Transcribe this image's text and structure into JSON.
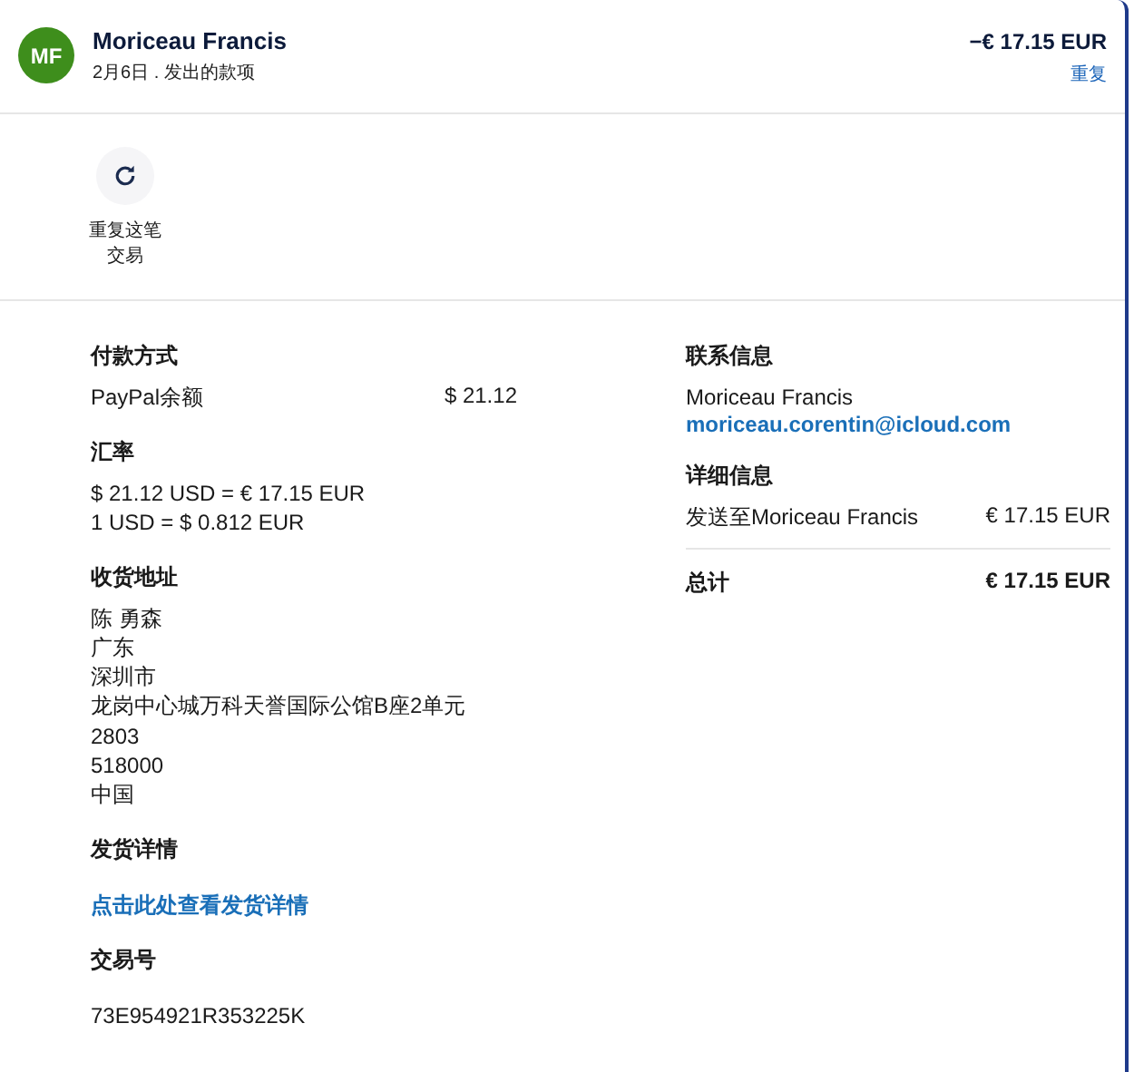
{
  "header": {
    "initials": "MF",
    "name": "Moriceau Francis",
    "subtitle": "2月6日 . 发出的款项",
    "amount": "−€ 17.15 EUR",
    "action": "重复"
  },
  "actions": [
    {
      "label": "重复这笔交易"
    }
  ],
  "left": {
    "payment": {
      "heading": "付款方式",
      "method": "PayPal余额",
      "amount": "$ 21.12"
    },
    "rate": {
      "heading": "汇率",
      "lines": [
        "$ 21.12 USD = € 17.15 EUR",
        "1 USD = $ 0.812 EUR"
      ]
    },
    "address": {
      "heading": "收货地址",
      "lines": [
        "陈 勇森",
        "广东",
        "深圳市",
        "龙岗中心城万科天誉国际公馆B座2单元",
        "2803",
        "518000",
        "中国"
      ]
    },
    "shipping": {
      "heading": "发货详情",
      "link": "点击此处查看发货详情"
    },
    "transaction": {
      "heading": "交易号",
      "id": "73E954921R353225K"
    }
  },
  "right": {
    "contact": {
      "heading": "联系信息",
      "name": "Moriceau Francis",
      "email": "moriceau.corentin@icloud.com"
    },
    "details": {
      "heading": "详细信息",
      "rows": [
        {
          "label": "发送至Moriceau Francis",
          "value": "€ 17.15 EUR"
        }
      ],
      "total": {
        "label": "总计",
        "value": "€ 17.15 EUR"
      }
    }
  }
}
